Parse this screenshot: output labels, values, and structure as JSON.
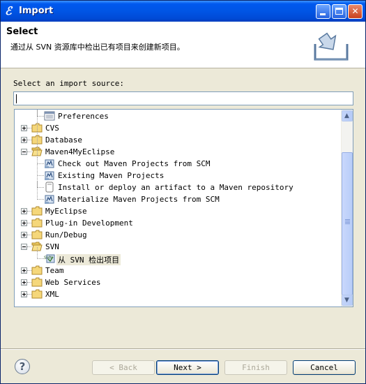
{
  "window": {
    "title": "Import",
    "icon": "eclipse-import-icon"
  },
  "header": {
    "title": "Select",
    "description": "通过从 SVN 资源库中检出已有项目来创建新项目。",
    "art_icon": "import-wizard-banner-icon"
  },
  "source": {
    "label": "Select an import source:",
    "label_mnemonic": "S",
    "input_value": ""
  },
  "tree": {
    "items": [
      {
        "label": "Preferences",
        "level": 1,
        "expander": "none",
        "icon": "preferences-icon"
      },
      {
        "label": "CVS",
        "level": 0,
        "expander": "plus",
        "icon": "folder-icon"
      },
      {
        "label": "Database",
        "level": 0,
        "expander": "plus",
        "icon": "folder-icon"
      },
      {
        "label": "Maven4MyEclipse",
        "level": 0,
        "expander": "minus",
        "icon": "folder-open-icon"
      },
      {
        "label": "Check out Maven Projects from SCM",
        "level": 1,
        "expander": "none",
        "icon": "maven-project-icon"
      },
      {
        "label": "Existing Maven Projects",
        "level": 1,
        "expander": "none",
        "icon": "maven-project-icon"
      },
      {
        "label": "Install or deploy an artifact to a Maven repository",
        "level": 1,
        "expander": "none",
        "icon": "artifact-icon"
      },
      {
        "label": "Materialize Maven Projects from SCM",
        "level": 1,
        "expander": "none",
        "icon": "maven-project-icon"
      },
      {
        "label": "MyEclipse",
        "level": 0,
        "expander": "plus",
        "icon": "folder-icon"
      },
      {
        "label": "Plug-in Development",
        "level": 0,
        "expander": "plus",
        "icon": "folder-icon"
      },
      {
        "label": "Run/Debug",
        "level": 0,
        "expander": "plus",
        "icon": "folder-icon"
      },
      {
        "label": "SVN",
        "level": 0,
        "expander": "minus",
        "icon": "folder-open-icon"
      },
      {
        "label": "从 SVN 检出项目",
        "level": 1,
        "expander": "none",
        "icon": "svn-checkout-icon",
        "selected": true
      },
      {
        "label": "Team",
        "level": 0,
        "expander": "plus",
        "icon": "folder-icon"
      },
      {
        "label": "Web Services",
        "level": 0,
        "expander": "plus",
        "icon": "folder-icon"
      },
      {
        "label": "XML",
        "level": 0,
        "expander": "plus",
        "icon": "folder-icon"
      }
    ]
  },
  "buttons": {
    "help_icon": "help-icon",
    "back": "< Back",
    "next": "Next >",
    "finish": "Finish",
    "cancel": "Cancel"
  },
  "colors": {
    "titlebar": "#0055e5",
    "dialog_bg": "#ece9d8",
    "selection_bg": "#ece9d8"
  }
}
